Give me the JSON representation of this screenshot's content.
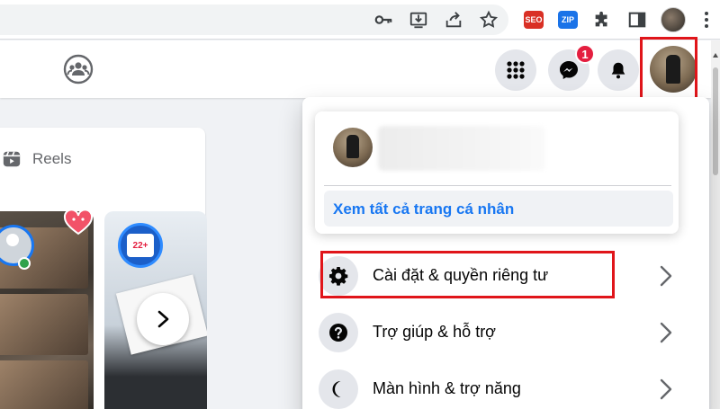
{
  "browser": {
    "extensions": [
      {
        "name": "key-icon"
      },
      {
        "name": "install-app-icon"
      },
      {
        "name": "share-icon"
      },
      {
        "name": "bookmark-star-icon"
      },
      {
        "name": "seo-extension-icon",
        "label": "SEO",
        "color": "#d93025"
      },
      {
        "name": "zip-extension-icon",
        "label": "ZIP",
        "color": "#1a73e8"
      },
      {
        "name": "puzzle-icon"
      },
      {
        "name": "side-panel-icon"
      },
      {
        "name": "kebab-menu-icon"
      }
    ]
  },
  "header": {
    "icons": [
      "groups-icon",
      "menu-grid-icon",
      "messenger-icon",
      "bell-icon",
      "account-avatar"
    ],
    "messenger_badge": "1"
  },
  "feed": {
    "reels_label": "Reels",
    "reel_badge": "22+"
  },
  "account_menu": {
    "see_profile_label": "Xem tất cả trang cá nhân",
    "items": [
      {
        "label": "Cài đặt & quyền riêng tư",
        "icon": "gear-icon"
      },
      {
        "label": "Trợ giúp & hỗ trợ",
        "icon": "help-icon"
      },
      {
        "label": "Màn hình & trợ năng",
        "icon": "moon-icon"
      }
    ]
  },
  "colors": {
    "accent": "#1877f2",
    "highlight": "#e0151a",
    "badge": "#e41e3f",
    "background": "#f0f2f5"
  }
}
